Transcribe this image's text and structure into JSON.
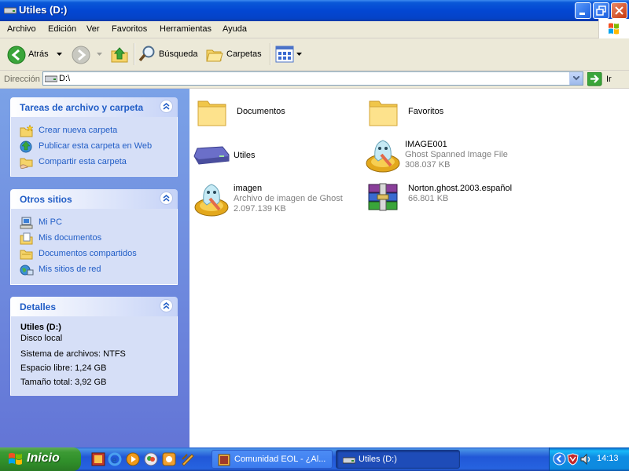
{
  "window": {
    "title": "Utiles (D:)",
    "icon": "drive-icon"
  },
  "menu": [
    "Archivo",
    "Edición",
    "Ver",
    "Favoritos",
    "Herramientas",
    "Ayuda"
  ],
  "toolbar": {
    "back_label": "Atrás",
    "search_label": "Búsqueda",
    "folders_label": "Carpetas"
  },
  "address": {
    "label": "Dirección",
    "value": "D:\\",
    "go_label": "Ir"
  },
  "tasks_panel": {
    "title": "Tareas de archivo y carpeta",
    "items": [
      "Crear nueva carpeta",
      "Publicar esta carpeta en Web",
      "Compartir esta carpeta"
    ]
  },
  "places_panel": {
    "title": "Otros sitios",
    "items": [
      "Mi PC",
      "Mis documentos",
      "Documentos compartidos",
      "Mis sitios de red"
    ]
  },
  "details_panel": {
    "title": "Detalles",
    "name": "Utiles (D:)",
    "type": "Disco local",
    "filesystem": "Sistema de archivos: NTFS",
    "free": "Espacio libre: 1,24 GB",
    "total": "Tamaño total: 3,92 GB"
  },
  "files": [
    {
      "name": "Documentos",
      "icon": "folder-icon"
    },
    {
      "name": "Favoritos",
      "icon": "folder-icon"
    },
    {
      "name": "Utiles",
      "icon": "drive-icon"
    },
    {
      "name": "IMAGE001",
      "type": "Ghost Spanned Image File",
      "size": "308.037 KB",
      "icon": "ghost-icon"
    },
    {
      "name": "imagen",
      "type": "Archivo de imagen de Ghost",
      "size": "2.097.139 KB",
      "icon": "ghost-icon"
    },
    {
      "name": "Norton.ghost.2003.español",
      "size": "66.801 KB",
      "icon": "winrar-icon"
    }
  ],
  "taskbar": {
    "start_label": "Inicio",
    "tasks": [
      "Comunidad EOL - ¿Al...",
      "Utiles (D:)"
    ],
    "clock": "14:13"
  },
  "colors": {
    "accent": "#215dc6",
    "title_bar": "#0a58d8",
    "panel_body": "#d6dff7"
  }
}
